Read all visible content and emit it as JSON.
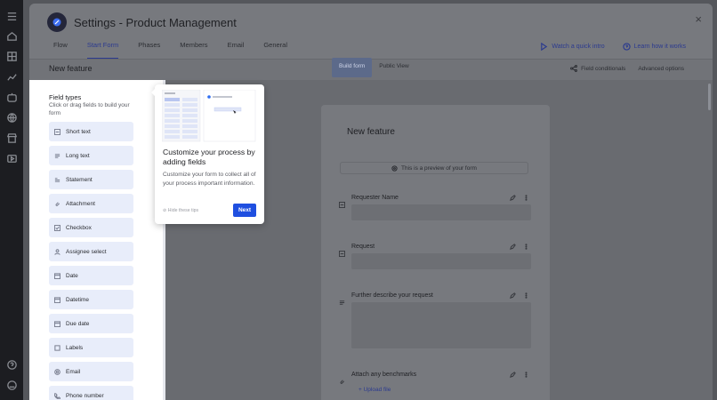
{
  "header": {
    "title": "Settings - Product Management",
    "close": "×",
    "tabs": [
      {
        "label": "Flow"
      },
      {
        "label": "Start Form",
        "active": true
      },
      {
        "label": "Phases"
      },
      {
        "label": "Members"
      },
      {
        "label": "Email"
      },
      {
        "label": "General"
      }
    ],
    "links": {
      "tutorial": "Watch a quick intro",
      "learn": "Learn how it works"
    }
  },
  "subbar": {
    "title": "New feature",
    "toggle": {
      "build": "Build form",
      "public": "Public View"
    },
    "field_conditionals": "Field conditionals",
    "advanced_options": "Advanced options"
  },
  "left_panel": {
    "title": "Field types",
    "description": "Click or drag fields to build your form",
    "fields": [
      {
        "label": "Short text",
        "icon": "short-text-icon"
      },
      {
        "label": "Long text",
        "icon": "long-text-icon"
      },
      {
        "label": "Statement",
        "icon": "statement-icon"
      },
      {
        "label": "Attachment",
        "icon": "attachment-icon"
      },
      {
        "label": "Checkbox",
        "icon": "checkbox-icon"
      },
      {
        "label": "Assignee select",
        "icon": "user-icon"
      },
      {
        "label": "Date",
        "icon": "calendar-icon"
      },
      {
        "label": "Datetime",
        "icon": "calendar-icon"
      },
      {
        "label": "Due date",
        "icon": "calendar-icon"
      },
      {
        "label": "Labels",
        "icon": "label-icon"
      },
      {
        "label": "Email",
        "icon": "email-icon"
      },
      {
        "label": "Phone number",
        "icon": "phone-icon"
      }
    ]
  },
  "form": {
    "title": "New feature",
    "preview_note": "This is a preview of your form",
    "questions": [
      {
        "label": "Requester Name"
      },
      {
        "label": "Request"
      },
      {
        "label": "Further describe your request"
      },
      {
        "label": "Attach any benchmarks",
        "upload": "Upload file"
      }
    ]
  },
  "tip": {
    "title": "Customize your process by adding fields",
    "body": "Customize your form to collect all of your process important information.",
    "hide": "Hide these tips",
    "next": "Next"
  },
  "colors": {
    "accent": "#1f4fe0",
    "tab_active": "#2b3a8f",
    "field_bg": "#e8edfa"
  }
}
